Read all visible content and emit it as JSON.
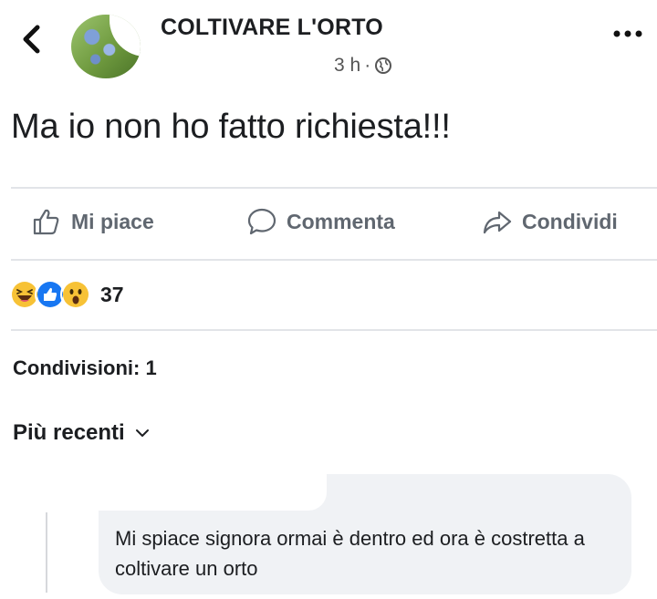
{
  "header": {
    "page_name": "COLTIVARE L'ORTO",
    "time": "3 h",
    "separator": "·"
  },
  "post": {
    "text": "Ma io non ho fatto richiesta!!!"
  },
  "actions": {
    "like": "Mi piace",
    "comment": "Commenta",
    "share": "Condividi"
  },
  "reactions": {
    "count": "37",
    "types": [
      "haha",
      "like",
      "wow"
    ]
  },
  "shares": {
    "label": "Condivisioni: 1"
  },
  "comments": {
    "sort_label": "Più recenti",
    "items": [
      {
        "text": "Mi spiace signora ormai è dentro ed ora è costretta a coltivare un orto"
      }
    ]
  },
  "colors": {
    "text": "#1c1e21",
    "secondary": "#606770",
    "like_blue": "#1877f2",
    "emoji_yellow": "#f7c236",
    "bubble": "#f0f2f5"
  },
  "icons": [
    "back-arrow-icon",
    "globe-icon",
    "more-dots-icon",
    "thumbs-up-icon",
    "comment-icon",
    "share-arrow-icon",
    "chevron-down-icon"
  ]
}
